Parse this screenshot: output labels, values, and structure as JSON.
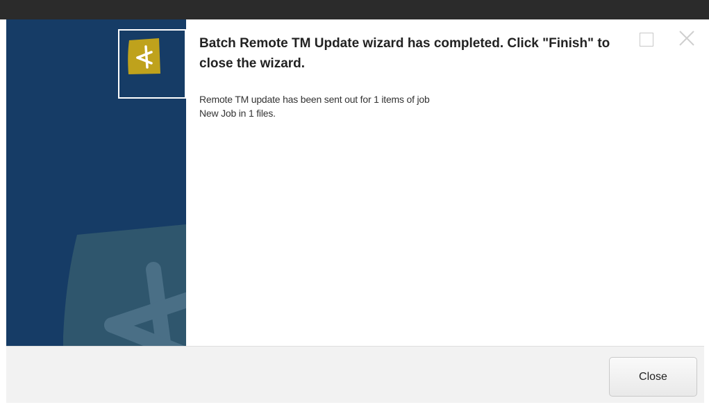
{
  "dialog": {
    "heading": "Batch Remote TM Update wizard has completed. Click \"Finish\" to close the wizard.",
    "message_lines": [
      "Remote TM update has been sent out for 1 items of job",
      "New Job in 1 files."
    ]
  },
  "window_controls": {
    "maximize_icon": "maximize-icon",
    "close_icon": "close-icon"
  },
  "footer": {
    "close_label": "Close"
  },
  "colors": {
    "titlebar": "#2b2b2b",
    "banner": "#163c66",
    "logo_badge": "#bfa21c",
    "footer": "#f2f2f2"
  }
}
